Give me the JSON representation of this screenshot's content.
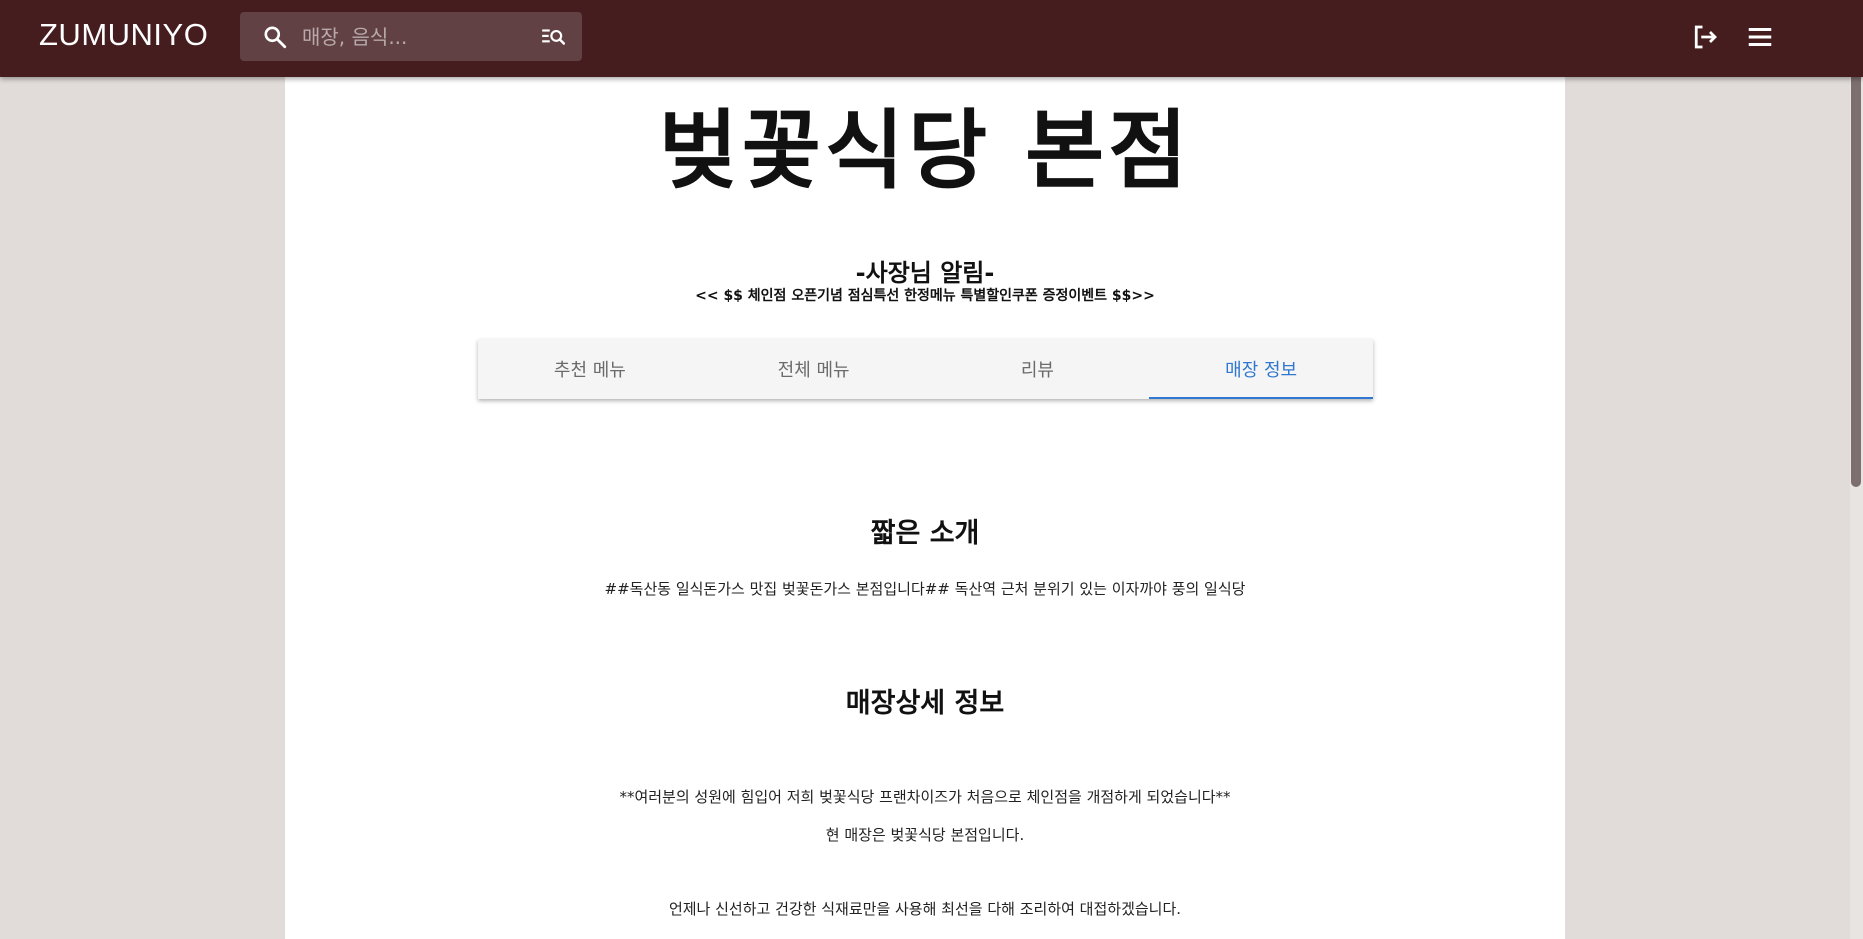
{
  "appbar": {
    "brand": "ZUMUNIYO",
    "search_placeholder": "매장, 음식...",
    "icons": [
      "search-icon",
      "advanced-search-icon",
      "logout-icon",
      "menu-icon"
    ],
    "background": "#451d1f"
  },
  "store": {
    "name": "벚꽃식당 본점",
    "notice_heading": "-사장님 알림-",
    "notice_text": "<< $$ 체인점 오픈기념 점심특선 한정메뉴 특별할인쿠폰 증정이벤트 $$>>"
  },
  "tabs": [
    {
      "label": "추천 메뉴",
      "active": false
    },
    {
      "label": "전체 메뉴",
      "active": false
    },
    {
      "label": "리뷰",
      "active": false
    },
    {
      "label": "매장 정보",
      "active": true
    }
  ],
  "info": {
    "intro_heading": "짧은 소개",
    "intro_text": "##독산동 일식돈가스 맛집 벚꽃돈가스 본점입니다## 독산역 근처 분위기 있는 이자까야 풍의 일식당",
    "detail_heading": "매장상세 정보",
    "detail_lines": [
      "**여러분의 성원에 힘입어 저희 벚꽃식당 프랜차이즈가 처음으로 체인점을 개점하게 되었습니다**",
      "현 매장은 벚꽃식당 본점입니다.",
      "언제나 신선하고 건강한 식재료만을 사용해 최선을 다해 조리하여 대접하겠습니다."
    ]
  },
  "colors": {
    "accent": "#2f77d0",
    "page_bg": "#e1dcd9"
  }
}
